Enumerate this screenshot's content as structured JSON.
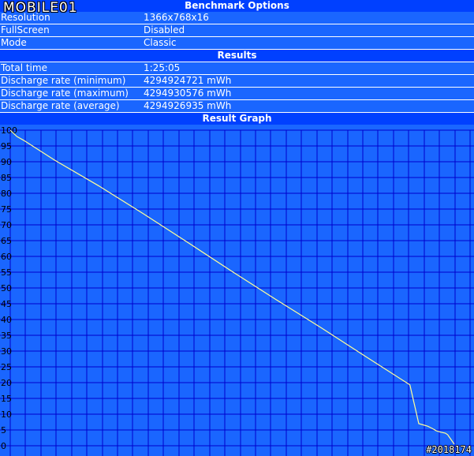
{
  "logo": {
    "text": "MOBILE01"
  },
  "sections": {
    "benchmark_options": "Benchmark Options",
    "results": "Results",
    "graph": "Result Graph"
  },
  "options": [
    {
      "label": "Resolution",
      "value": "1366x768x16"
    },
    {
      "label": "FullScreen",
      "value": "Disabled"
    },
    {
      "label": "Mode",
      "value": "Classic"
    }
  ],
  "results": [
    {
      "label": "Total time",
      "value": "1:25:05"
    },
    {
      "label": "Discharge rate (minimum)",
      "value": "4294924721 mWh"
    },
    {
      "label": "Discharge rate (maximum)",
      "value": "4294930576 mWh"
    },
    {
      "label": "Discharge rate (average)",
      "value": "4294926935 mWh"
    }
  ],
  "watermark": "#2018174",
  "colors": {
    "header_bg": "#0040ff",
    "row_bg": "#1a66ff",
    "plot_bg": "#1a66ff",
    "grid": "#0000cc",
    "line": "#ffff99"
  },
  "chart_data": {
    "type": "line",
    "title": "",
    "xlabel": "",
    "ylabel": "",
    "ylim": [
      0,
      100
    ],
    "yticks": [
      0,
      5,
      10,
      15,
      20,
      25,
      30,
      35,
      40,
      45,
      50,
      55,
      60,
      65,
      70,
      75,
      80,
      85,
      90,
      95,
      100
    ],
    "xlim": [
      0,
      100
    ],
    "grid": true,
    "series": [
      {
        "x": [
          0,
          1.5,
          3,
          10,
          20,
          30,
          40,
          50,
          60,
          70,
          80,
          90,
          92,
          94,
          95,
          96,
          97,
          98,
          98.5,
          99,
          99.5,
          100
        ],
        "y": [
          100,
          98,
          96.8,
          90.5,
          82.3,
          73.5,
          64.4,
          55.2,
          46.2,
          37.4,
          28.3,
          19.3,
          7,
          6.2,
          5.5,
          4.7,
          4.3,
          4,
          3.5,
          2.5,
          1.5,
          0.5
        ]
      }
    ]
  }
}
